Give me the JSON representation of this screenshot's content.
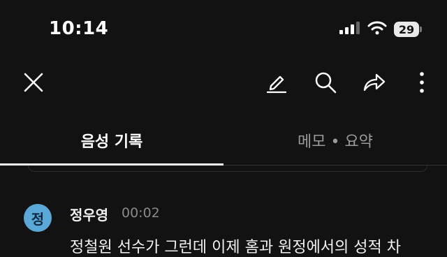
{
  "status_bar": {
    "time": "10:14",
    "battery_level": "29",
    "icons": [
      "signal-icon",
      "wifi-icon",
      "battery-icon"
    ]
  },
  "toolbar": {
    "icons": [
      "close-icon",
      "edit-icon",
      "search-icon",
      "share-icon",
      "more-vertical-icon"
    ]
  },
  "tabs": [
    {
      "label": "음성 기록",
      "active": true
    },
    {
      "label": "메모 • 요약",
      "active": false
    }
  ],
  "message": {
    "avatar_initial": "정",
    "speaker": "정우영",
    "timestamp": "00:02",
    "text": "정철원 선수가 그런데 이제 홈과 원정에서의 성적 차"
  },
  "colors": {
    "background": "#121212",
    "avatar": "#5aa8d8",
    "inactive_tab": "#9a9a9a"
  }
}
